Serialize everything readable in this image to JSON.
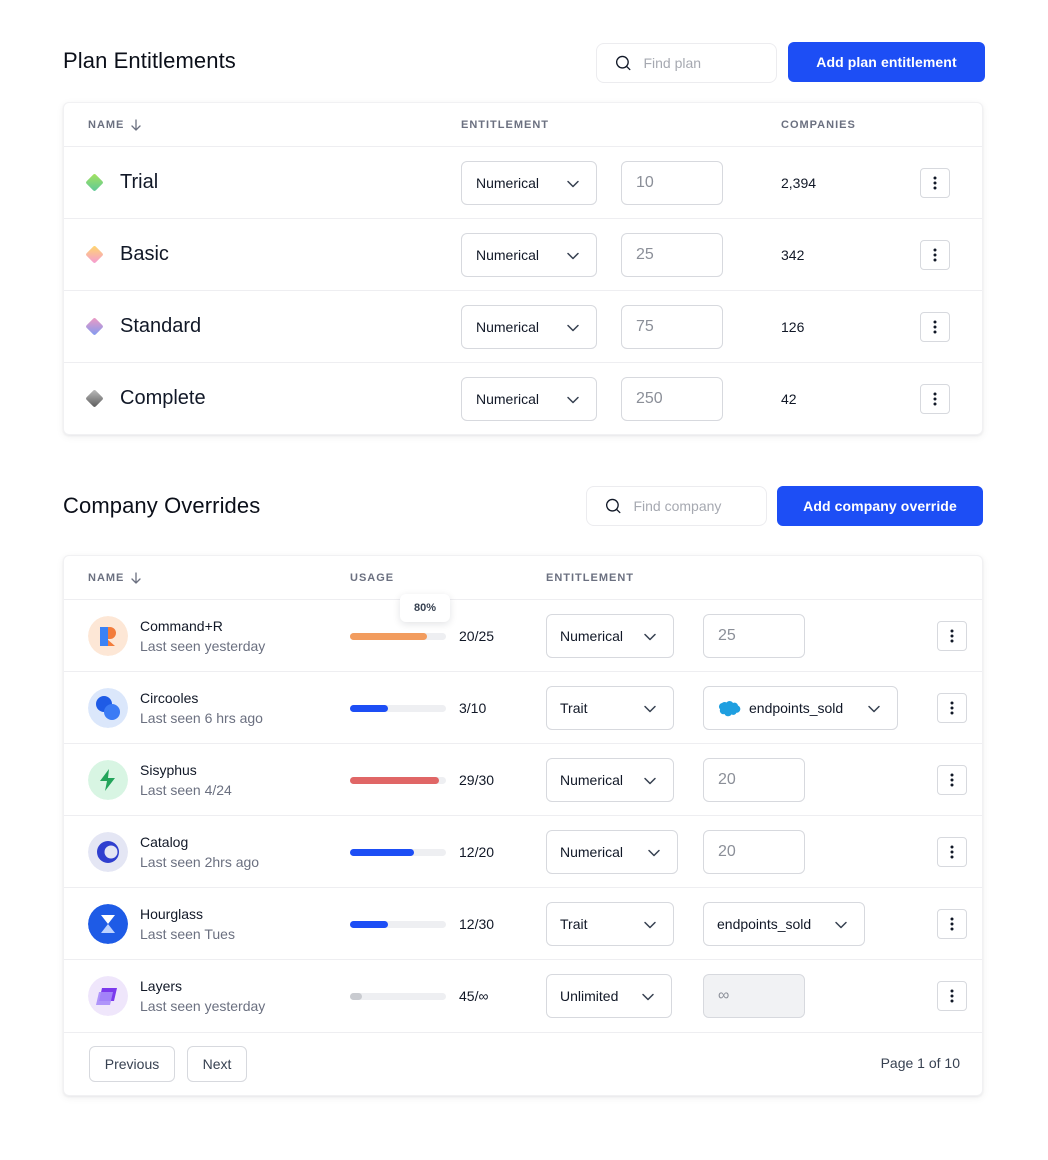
{
  "plan_section": {
    "title": "Plan Entitlements",
    "search_placeholder": "Find plan",
    "add_button": "Add plan entitlement",
    "columns": {
      "name": "NAME",
      "entitlement": "ENTITLEMENT",
      "companies": "COMPANIES"
    },
    "rows": [
      {
        "name": "Trial",
        "entitlement": "Numerical",
        "value": "10",
        "companies": "2,394",
        "icon_color_a": "#a6e35e",
        "icon_color_b": "#5cc89a"
      },
      {
        "name": "Basic",
        "entitlement": "Numerical",
        "value": "25",
        "companies": "342",
        "icon_color_a": "#ffd86b",
        "icon_color_b": "#f59ad6"
      },
      {
        "name": "Standard",
        "entitlement": "Numerical",
        "value": "75",
        "companies": "126",
        "icon_color_a": "#f09ac2",
        "icon_color_b": "#7f9bf2"
      },
      {
        "name": "Complete",
        "entitlement": "Numerical",
        "value": "250",
        "companies": "42",
        "icon_color_a": "#bdbdbd",
        "icon_color_b": "#5a5a5a"
      }
    ]
  },
  "company_section": {
    "title": "Company Overrides",
    "search_placeholder": "Find company",
    "add_button": "Add company override",
    "columns": {
      "name": "NAME",
      "usage": "USAGE",
      "entitlement": "ENTITLEMENT"
    },
    "tooltip": "80%",
    "rows": [
      {
        "name": "Command+R",
        "seen": "Last seen yesterday",
        "usage": "20/25",
        "usage_fraction": 0.8,
        "bar_color": "#f29c5e",
        "entitlement": "Numerical",
        "value": "25",
        "value_type": "number",
        "avatar": "command-r-logo"
      },
      {
        "name": "Circooles",
        "seen": "Last seen 6 hrs ago",
        "usage": "3/10",
        "usage_fraction": 0.4,
        "bar_color": "#1d4ef5",
        "entitlement": "Trait",
        "value": "endpoints_sold",
        "value_type": "trait-salesforce",
        "avatar": "circooles-logo"
      },
      {
        "name": "Sisyphus",
        "seen": "Last seen 4/24",
        "usage": "29/30",
        "usage_fraction": 0.93,
        "bar_color": "#e06666",
        "entitlement": "Numerical",
        "value": "20",
        "value_type": "number",
        "avatar": "sisyphus-logo"
      },
      {
        "name": "Catalog",
        "seen": "Last seen 2hrs ago",
        "usage": "12/20",
        "usage_fraction": 0.67,
        "bar_color": "#1d4ef5",
        "entitlement": "Numerical",
        "value": "20",
        "value_type": "number",
        "avatar": "catalog-logo"
      },
      {
        "name": "Hourglass",
        "seen": "Last seen Tues",
        "usage": "12/30",
        "usage_fraction": 0.4,
        "bar_color": "#1d4ef5",
        "entitlement": "Trait",
        "value": "endpoints_sold",
        "value_type": "trait",
        "avatar": "hourglass-logo"
      },
      {
        "name": "Layers",
        "seen": "Last seen yesterday",
        "usage": "45/∞",
        "usage_fraction": 0.13,
        "bar_color": "#c9cbd0",
        "entitlement": "Unlimited",
        "value": "∞",
        "value_type": "disabled",
        "avatar": "layers-logo"
      }
    ],
    "pagination": {
      "previous": "Previous",
      "next": "Next",
      "page_text": "Page 1 of 10"
    }
  },
  "colors": {
    "primary": "#1d4ef5",
    "border": "#d7d9de",
    "muted": "#6b7080"
  }
}
